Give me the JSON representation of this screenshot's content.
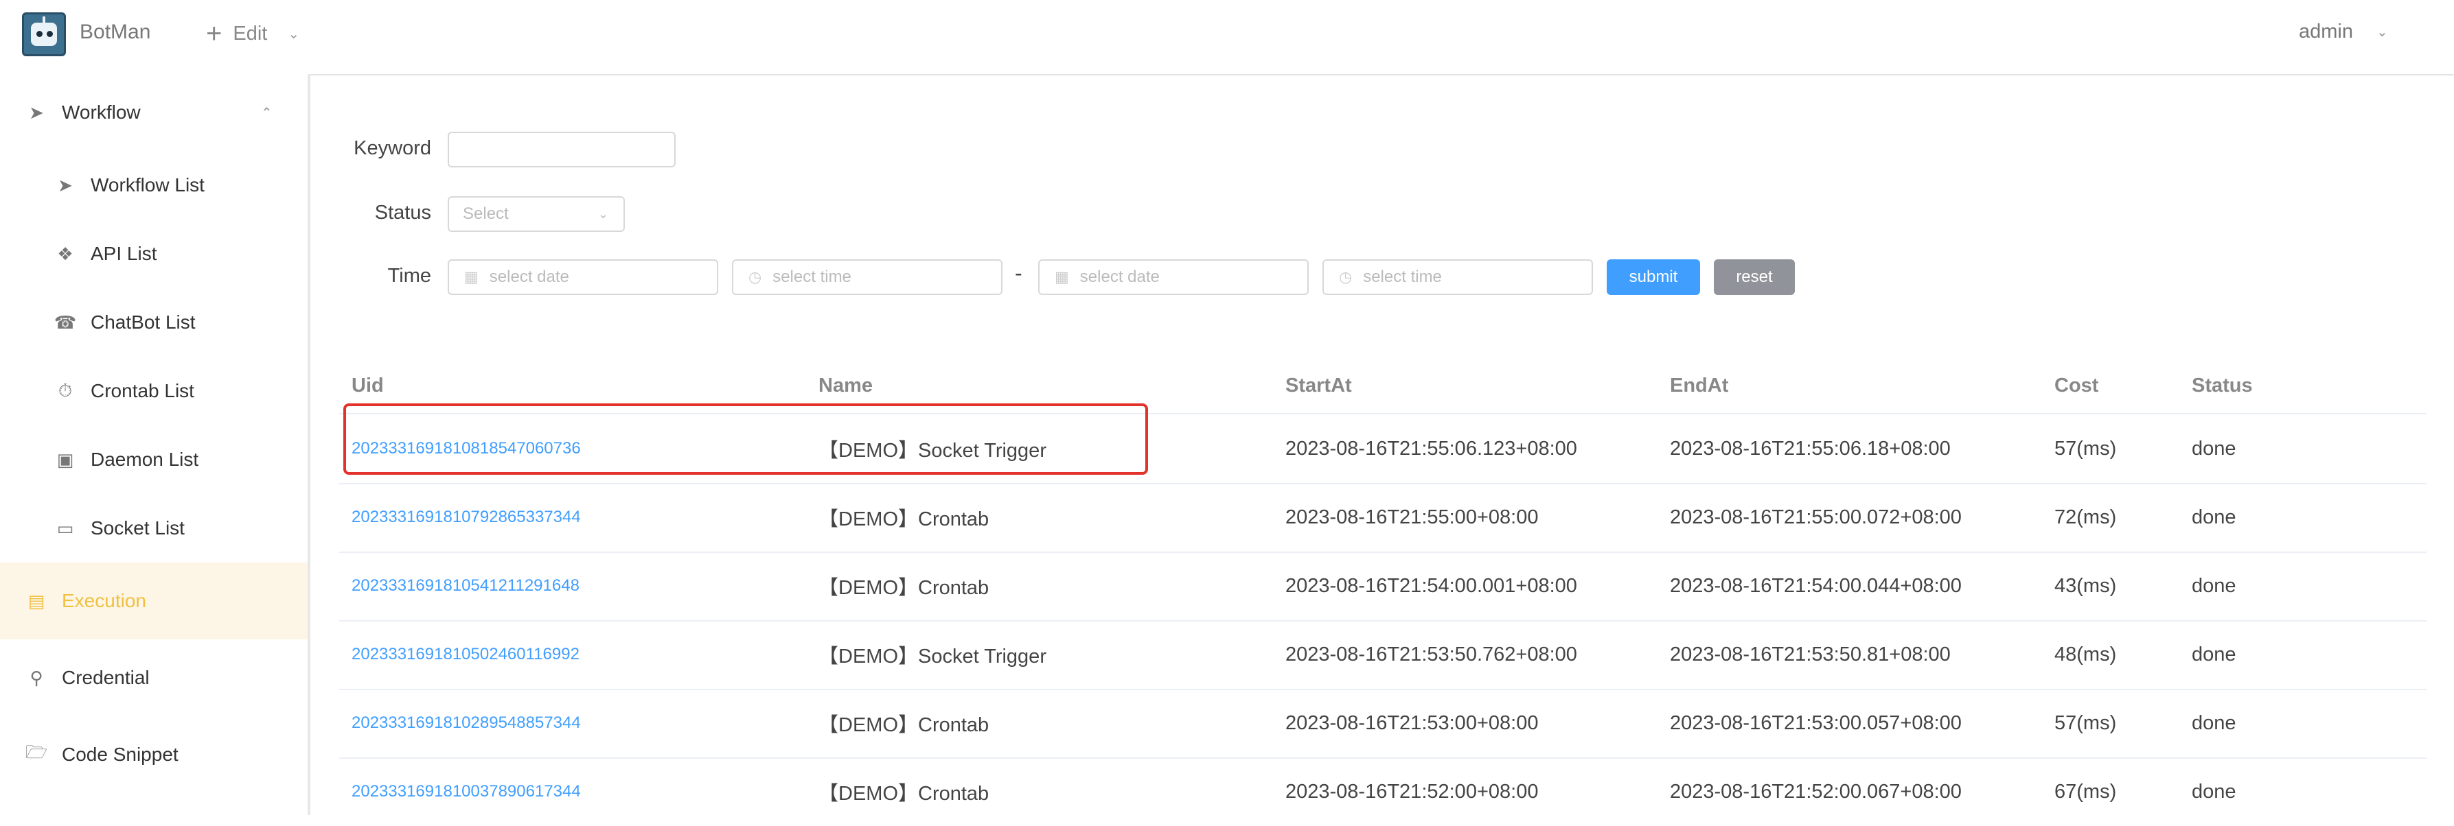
{
  "header": {
    "app_name": "BotMan",
    "edit_label": "Edit",
    "user_label": "admin"
  },
  "sidebar": {
    "items": [
      {
        "label": "Workflow",
        "icon": "send-icon"
      },
      {
        "label": "Workflow List",
        "icon": "send-icon"
      },
      {
        "label": "API List",
        "icon": "api-icon"
      },
      {
        "label": "ChatBot List",
        "icon": "headset-icon"
      },
      {
        "label": "Crontab List",
        "icon": "timer-icon"
      },
      {
        "label": "Daemon List",
        "icon": "daemon-icon"
      },
      {
        "label": "Socket List",
        "icon": "monitor-icon"
      },
      {
        "label": "Execution",
        "icon": "document-icon"
      },
      {
        "label": "Credential",
        "icon": "key-icon"
      },
      {
        "label": "Code Snippet",
        "icon": "folder-icon"
      }
    ]
  },
  "filters": {
    "keyword_label": "Keyword",
    "keyword_value": "",
    "status_label": "Status",
    "status_placeholder": "Select",
    "time_label": "Time",
    "start_date_placeholder": "select date",
    "start_time_placeholder": "select time",
    "separator": "-",
    "end_date_placeholder": "select date",
    "end_time_placeholder": "select time",
    "submit_label": "submit",
    "reset_label": "reset"
  },
  "table": {
    "columns": [
      "Uid",
      "Name",
      "StartAt",
      "EndAt",
      "Cost",
      "Status"
    ],
    "rows": [
      {
        "uid": "20233316918108185470607​36",
        "name": "【DEMO】Socket Trigger",
        "start": "2023-08-16T21:55:06.123+08:00",
        "end": "2023-08-16T21:55:06.18+08:00",
        "cost": "57(ms)",
        "status": "done"
      },
      {
        "uid": "202333169181079286533​7344",
        "name": "【DEMO】Crontab",
        "start": "2023-08-16T21:55:00+08:00",
        "end": "2023-08-16T21:55:00.072+08:00",
        "cost": "72(ms)",
        "status": "done"
      },
      {
        "uid": "2023331691810541211291648",
        "name": "【DEMO】Crontab",
        "start": "2023-08-16T21:54:00.001+08:00",
        "end": "2023-08-16T21:54:00.044+08:00",
        "cost": "43(ms)",
        "status": "done"
      },
      {
        "uid": "2023331691810502460116992",
        "name": "【DEMO】Socket Trigger",
        "start": "2023-08-16T21:53:50.762+08:00",
        "end": "2023-08-16T21:53:50.81+08:00",
        "cost": "48(ms)",
        "status": "done"
      },
      {
        "uid": "2023331691810289548857344",
        "name": "【DEMO】Crontab",
        "start": "2023-08-16T21:53:00+08:00",
        "end": "2023-08-16T21:53:00.057+08:00",
        "cost": "57(ms)",
        "status": "done"
      },
      {
        "uid": "2023331691810037890617344",
        "name": "【DEMO】Crontab",
        "start": "2023-08-16T21:52:00+08:00",
        "end": "2023-08-16T21:52:00.067+08:00",
        "cost": "67(ms)",
        "status": "done"
      }
    ]
  },
  "colors": {
    "accent": "#409eff",
    "active_nav": "#f0c040",
    "highlight": "#e3322b"
  }
}
